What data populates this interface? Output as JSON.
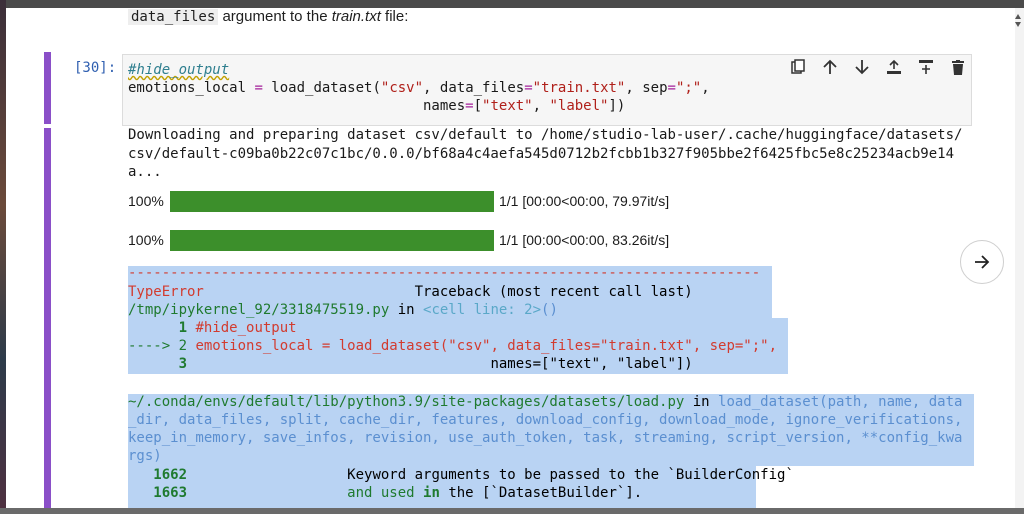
{
  "markdown": {
    "code": "data_files",
    "text_mid": " argument to the ",
    "em": "train.txt",
    "text_end": " file:"
  },
  "cell": {
    "prompt": "[30]:",
    "code_line1_comment": "#hide_output",
    "code_line2a": "emotions_local ",
    "code_line2_eq": "=",
    "code_line2b": " load_dataset(",
    "code_line2_s1": "\"csv\"",
    "code_line2c": ", data_files",
    "code_line2_eq2": "=",
    "code_line2_s2": "\"train.txt\"",
    "code_line2d": ", sep",
    "code_line2_eq3": "=",
    "code_line2_s3": "\";\"",
    "code_line2e": ",",
    "code_line3_indent": "                                   names",
    "code_line3_eq": "=",
    "code_line3a": "[",
    "code_line3_s1": "\"text\"",
    "code_line3b": ", ",
    "code_line3_s2": "\"label\"",
    "code_line3c": "])"
  },
  "toolbar": {
    "copy": "copy-icon",
    "up": "arrow-up-icon",
    "down": "arrow-down-icon",
    "insert_above": "insert-above-icon",
    "insert_below": "insert-below-icon",
    "delete": "trash-icon"
  },
  "output": {
    "line1": "Downloading and preparing dataset csv/default to /home/studio-lab-user/.cache/huggingface/datasets/",
    "line2": "csv/default-c09ba0b22c07c1bc/0.0.0/bf68a4c4aefa545d0712b2fcbb1b327f905bbe2f6425fbc5e8c25234acb9e14",
    "line3": "a...",
    "progress": [
      {
        "pct_label": "100%",
        "value": 1.0,
        "stats": "1/1 [00:00<00:00, 79.97it/s]"
      },
      {
        "pct_label": "100%",
        "value": 1.0,
        "stats": "1/1 [00:00<00:00, 83.26it/s]"
      }
    ]
  },
  "traceback": {
    "dashes": "---------------------------------------------------------------------------",
    "error_name": "TypeError",
    "header_right": "                         Traceback (most recent call last)",
    "file1": "/tmp/ipykernel_92/3318475519.py",
    "file1_in": " in ",
    "file1_loc": "<cell line: 2>",
    "file1_paren": "()",
    "l1_num": "      1",
    "l1_code": " #hide_output",
    "l2_arrow": "----> 2",
    "l2_code": " emotions_local = load_dataset(\"csv\", data_files=\"train.txt\", sep=\";\",",
    "l3_num": "      3",
    "l3_code": "                                    names=[\"text\", \"label\"])",
    "file2": "~/.conda/envs/default/lib/python3.9/site-packages/datasets/load.py",
    "file2_in": " in ",
    "file2_func": "load_dataset",
    "file2_args1": "(path, name, data",
    "args_line2": "_dir, data_files, split, cache_dir, features, download_config, download_mode, ignore_verifications,",
    "args_line3": "keep_in_memory, save_infos, revision, use_auth_token, task, streaming, script_version, **config_kwa",
    "args_line4": "rgs)",
    "n1662": "   1662",
    "n1662_code": "                   Keyword arguments to be passed to the `BuilderConfig`",
    "n1663": "   1663",
    "n1663_a": "                   and used ",
    "n1663_in": "in",
    "n1663_b": " the [`DatasetBuilder`]."
  },
  "colors": {
    "cell_bar": "#8a4fc8",
    "progress": "#3c8f2b",
    "selection": "#b9d3f3",
    "error_red": "#d23b2f"
  },
  "run_next_button": "arrow-right-circle-icon"
}
